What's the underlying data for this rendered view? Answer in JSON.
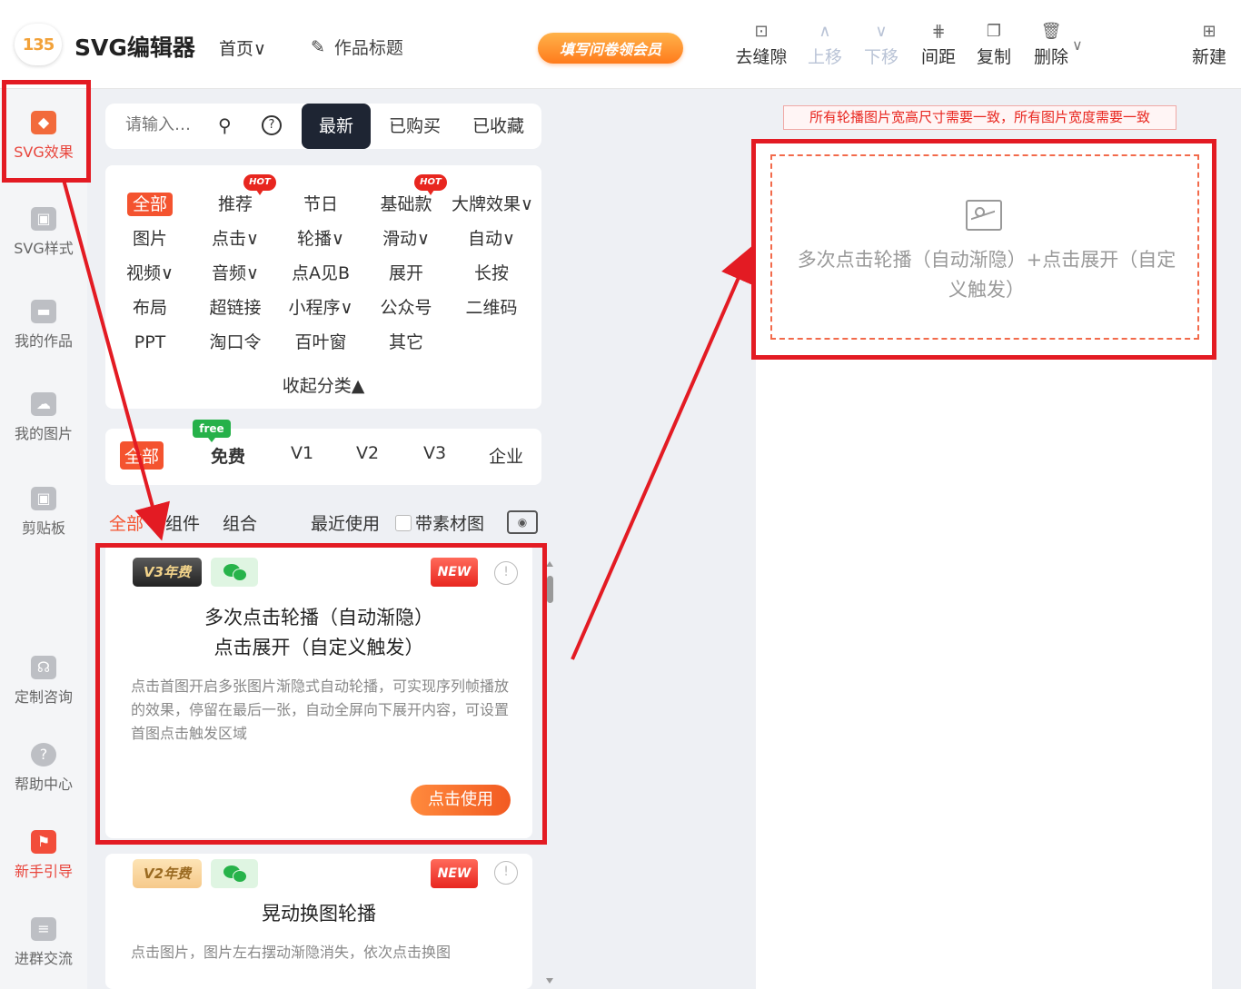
{
  "header": {
    "logo": "135",
    "brand": "SVG编辑器",
    "home": "首页",
    "title_edit": "作品标题",
    "vip": "填写问卷领会员",
    "tools": [
      {
        "label": "去缝隙",
        "icon": "gap-icon",
        "glyph": "⊡",
        "disabled": false
      },
      {
        "label": "上移",
        "icon": "move-up-icon",
        "glyph": "∧",
        "disabled": true
      },
      {
        "label": "下移",
        "icon": "move-down-icon",
        "glyph": "∨",
        "disabled": true
      },
      {
        "label": "间距",
        "icon": "spacing-icon",
        "glyph": "⋕",
        "disabled": false
      },
      {
        "label": "复制",
        "icon": "copy-icon",
        "glyph": "❐",
        "disabled": false
      },
      {
        "label": "删除",
        "icon": "trash-icon",
        "glyph": "🗑",
        "disabled": false
      }
    ],
    "new": "新建"
  },
  "rail": {
    "items": [
      {
        "label": "SVG效果",
        "icon": "cube-icon",
        "glyph": "◆"
      },
      {
        "label": "SVG样式",
        "icon": "style-icon",
        "glyph": "▣"
      },
      {
        "label": "我的作品",
        "icon": "folder-icon",
        "glyph": "▬"
      },
      {
        "label": "我的图片",
        "icon": "cloud-icon",
        "glyph": "☁"
      },
      {
        "label": "剪贴板",
        "icon": "clipboard-icon",
        "glyph": "▣"
      },
      {
        "label": "定制咨询",
        "icon": "headset-icon",
        "glyph": "☊"
      },
      {
        "label": "帮助中心",
        "icon": "help-circle-icon",
        "glyph": "?"
      },
      {
        "label": "新手引导",
        "icon": "guide-icon",
        "glyph": "⚑"
      },
      {
        "label": "进群交流",
        "icon": "document-icon",
        "glyph": "≡"
      }
    ]
  },
  "search": {
    "placeholder": "请输入…"
  },
  "tabs": {
    "newest": "最新",
    "bought": "已购买",
    "favorited": "已收藏"
  },
  "categories": {
    "rows": [
      [
        "全部",
        "推荐",
        "节日",
        "基础款",
        "大牌效果∨"
      ],
      [
        "图片",
        "点击∨",
        "轮播∨",
        "滑动∨",
        "自动∨"
      ],
      [
        "视频∨",
        "音频∨",
        "点A见B",
        "展开",
        "长按"
      ],
      [
        "布局",
        "超链接",
        "小程序∨",
        "公众号",
        "二维码"
      ],
      [
        "PPT",
        "淘口令",
        "百叶窗",
        "其它"
      ]
    ],
    "hot": "HOT",
    "collapse": "收起分类▲"
  },
  "price": {
    "all": "全部",
    "free": "免费",
    "free_badge": "free",
    "v1": "V1",
    "v2": "V2",
    "v3": "V3",
    "enterprise": "企业"
  },
  "filter": {
    "all": "全部",
    "component": "组件",
    "combo": "组合",
    "recent": "最近使用",
    "with_material": "带素材图"
  },
  "cards": [
    {
      "tag": "V3年费",
      "new": "NEW",
      "title_line1": "多次点击轮播（自动渐隐）",
      "title_line2": "点击展开（自定义触发）",
      "desc": "点击首图开启多张图片渐隐式自动轮播，可实现序列帧播放的效果，停留在最后一张，自动全屏向下展开内容，可设置首图点击触发区域",
      "button": "点击使用"
    },
    {
      "tag": "V2年费",
      "new": "NEW",
      "title_line1": "晃动换图轮播",
      "desc": "点击图片，图片左右摆动渐隐消失，依次点击换图"
    }
  ],
  "canvas": {
    "notice": "所有轮播图片宽高尺寸需要一致，所有图片宽度需要一致",
    "placeholder_text": "多次点击轮播（自动渐隐）+点击展开（自定义触发）"
  },
  "colors": {
    "accent": "#f4532f",
    "annotation": "#e31b23",
    "dark_tab": "#1e2533"
  }
}
